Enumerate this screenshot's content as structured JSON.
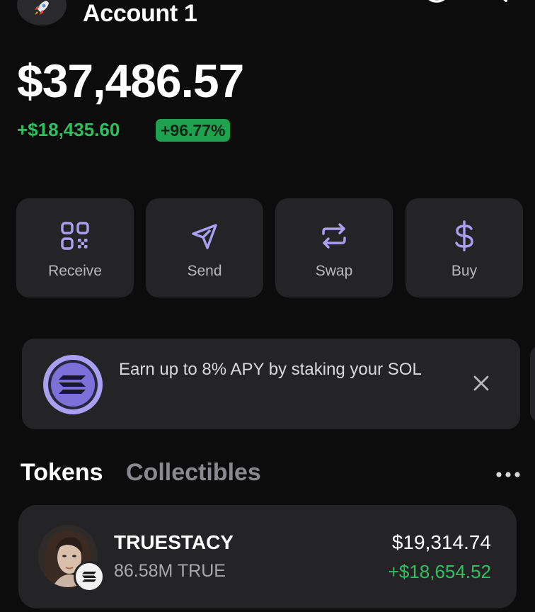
{
  "header": {
    "account_name": "Account 1",
    "avatar_icon": "rocket-icon",
    "history_icon": "clock-icon",
    "search_icon": "search-icon"
  },
  "balance": {
    "total": "$37,486.57",
    "change": "+$18,435.60",
    "change_percent": "+96.77%"
  },
  "actions": [
    {
      "label": "Receive",
      "icon": "qr-code-icon"
    },
    {
      "label": "Send",
      "icon": "paper-plane-icon"
    },
    {
      "label": "Swap",
      "icon": "swap-arrows-icon"
    },
    {
      "label": "Buy",
      "icon": "dollar-icon"
    }
  ],
  "banner": {
    "text": "Earn up to 8% APY by staking your SOL",
    "icon": "solana-logo-icon",
    "close_icon": "close-icon"
  },
  "tabs": {
    "tokens": "Tokens",
    "collectibles": "Collectibles",
    "more_icon": "more-dots-icon"
  },
  "tokens": [
    {
      "name": "TRUESTACY",
      "amount": "86.58M TRUE",
      "value": "$19,314.74",
      "change": "+$18,654.52",
      "chain_icon": "solana-badge-icon"
    }
  ],
  "colors": {
    "background": "#0c0c0c",
    "card": "#242426",
    "accent_purple": "#ab9ff2",
    "positive_green": "#2ec05d",
    "badge_green": "#1ea250"
  }
}
